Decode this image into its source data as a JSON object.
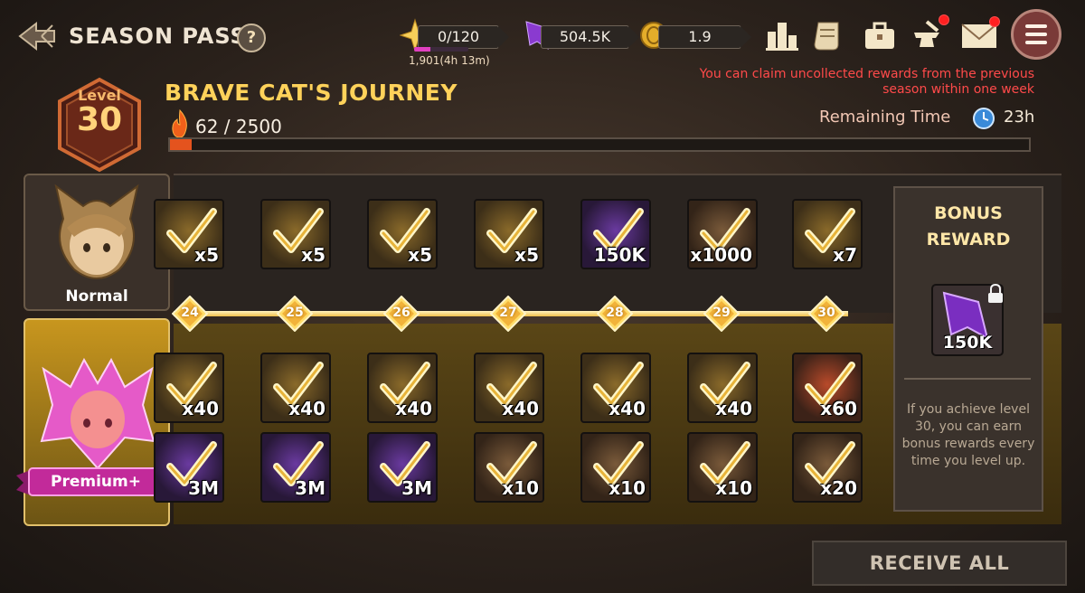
{
  "header": {
    "title": "SEASON PASS",
    "help_glyph": "?",
    "resources": [
      {
        "name": "stamina",
        "value": "0/120",
        "icon": "star-icon"
      },
      {
        "name": "crystals",
        "value": "504.5K",
        "icon": "purple-crystal-icon"
      },
      {
        "name": "coins",
        "value": "1.9",
        "icon": "gold-coin-icon"
      }
    ],
    "stamina_sub": "1,901(4h 13m)",
    "stamina_fill_fraction": 0.3,
    "icons": [
      "ranking-icon",
      "scroll-icon",
      "inventory-bag-icon",
      "forge-anvil-icon",
      "mail-icon",
      "menu-icon"
    ]
  },
  "notice": "You can claim uncollected rewards from the previous season within one week",
  "remaining": {
    "label": "Remaining Time",
    "value": "23h"
  },
  "level": {
    "label": "Level",
    "value": "30"
  },
  "journey": {
    "title": "BRAVE CAT'S JOURNEY",
    "xp": "62 / 2500",
    "xp_fraction": 0.025
  },
  "tracks": {
    "normal_label": "Normal",
    "premium_label": "Premium+",
    "levels": [
      "24",
      "25",
      "26",
      "27",
      "28",
      "29",
      "30"
    ],
    "normal": [
      {
        "qty": "x5",
        "kind": "gold"
      },
      {
        "qty": "x5",
        "kind": "gold"
      },
      {
        "qty": "x5",
        "kind": "gold"
      },
      {
        "qty": "x5",
        "kind": "gold"
      },
      {
        "qty": "150K",
        "kind": "purple"
      },
      {
        "qty": "x1000",
        "kind": "scroll"
      },
      {
        "qty": "x7",
        "kind": "gold"
      }
    ],
    "premium_top": [
      {
        "qty": "x40",
        "kind": "gold"
      },
      {
        "qty": "x40",
        "kind": "gold"
      },
      {
        "qty": "x40",
        "kind": "gold"
      },
      {
        "qty": "x40",
        "kind": "gold"
      },
      {
        "qty": "x40",
        "kind": "gold"
      },
      {
        "qty": "x40",
        "kind": "gold"
      },
      {
        "qty": "x60",
        "kind": "red"
      }
    ],
    "premium_bottom": [
      {
        "qty": "3M",
        "kind": "purple"
      },
      {
        "qty": "3M",
        "kind": "purple"
      },
      {
        "qty": "3M",
        "kind": "purple"
      },
      {
        "qty": "x10",
        "kind": "scroll"
      },
      {
        "qty": "x10",
        "kind": "scroll"
      },
      {
        "qty": "x10",
        "kind": "scroll"
      },
      {
        "qty": "x20",
        "kind": "scroll"
      }
    ]
  },
  "bonus": {
    "title": "BONUS REWARD",
    "qty": "150K",
    "description": "If you achieve level 30, you can earn bonus rewards every time you level up."
  },
  "receive_all": "RECEIVE ALL",
  "colors": {
    "accent_gold": "#ffd25a",
    "notice_red": "#ff4a4a",
    "xp_orange": "#e4531e"
  }
}
